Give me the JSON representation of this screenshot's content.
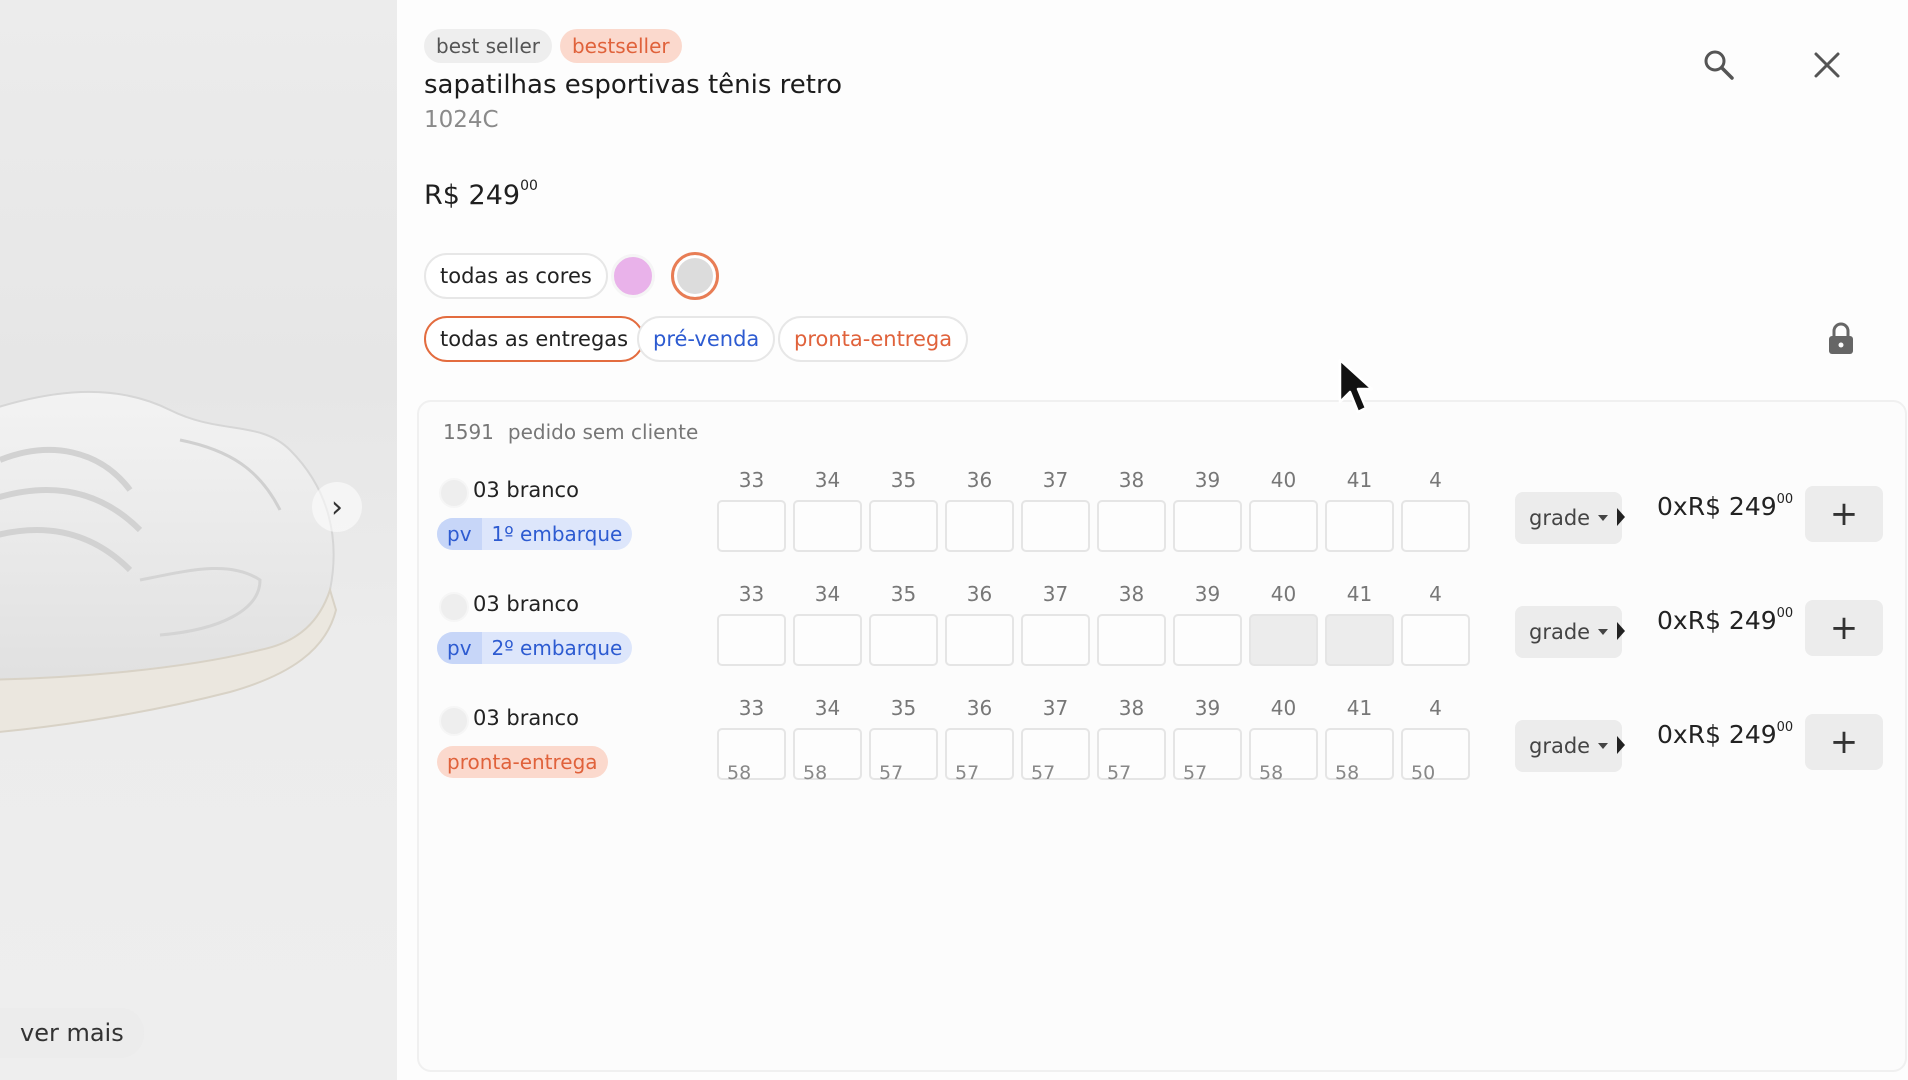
{
  "left_panel": {
    "more_label": "ver mais"
  },
  "header": {
    "tags": [
      "best seller",
      "bestseller"
    ],
    "title": "sapatilhas esportivas tênis retro",
    "code": "1024C",
    "price_main": "R$ 249",
    "price_cents": "00"
  },
  "filters": {
    "all_colors": "todas as cores",
    "colors": [
      {
        "name": "rosa",
        "hex": "#e9b2ea"
      },
      {
        "name": "branco",
        "hex": "#dcdcdc"
      }
    ],
    "all_deliveries": "todas as entregas",
    "pre_sale": "pré-venda",
    "ready": "pronta-entrega"
  },
  "order": {
    "number": "1591",
    "label": "pedido sem cliente",
    "sizes": [
      "33",
      "34",
      "35",
      "36",
      "37",
      "38",
      "39",
      "40",
      "41",
      "4"
    ],
    "rows": [
      {
        "color": "03 branco",
        "delivery_type": "pv",
        "delivery_code": "pv",
        "delivery_name": "1º embarque",
        "stock": [],
        "grade_label": "grade",
        "qty": "0x",
        "total_main": "R$ 249",
        "total_cents": "00"
      },
      {
        "color": "03 branco",
        "delivery_type": "pv",
        "delivery_code": "pv",
        "delivery_name": "2º embarque",
        "stock": [],
        "grade_label": "grade",
        "qty": "0x",
        "total_main": "R$ 249",
        "total_cents": "00"
      },
      {
        "color": "03 branco",
        "delivery_type": "pe",
        "delivery_name": "pronta-entrega",
        "stock": [
          "58",
          "58",
          "57",
          "57",
          "57",
          "57",
          "57",
          "58",
          "58",
          "50"
        ],
        "grade_label": "grade",
        "qty": "0x",
        "total_main": "R$ 249",
        "total_cents": "00"
      }
    ]
  },
  "colors": {
    "accent_orange": "#e36c3f",
    "accent_blue": "#2d5bd1"
  }
}
